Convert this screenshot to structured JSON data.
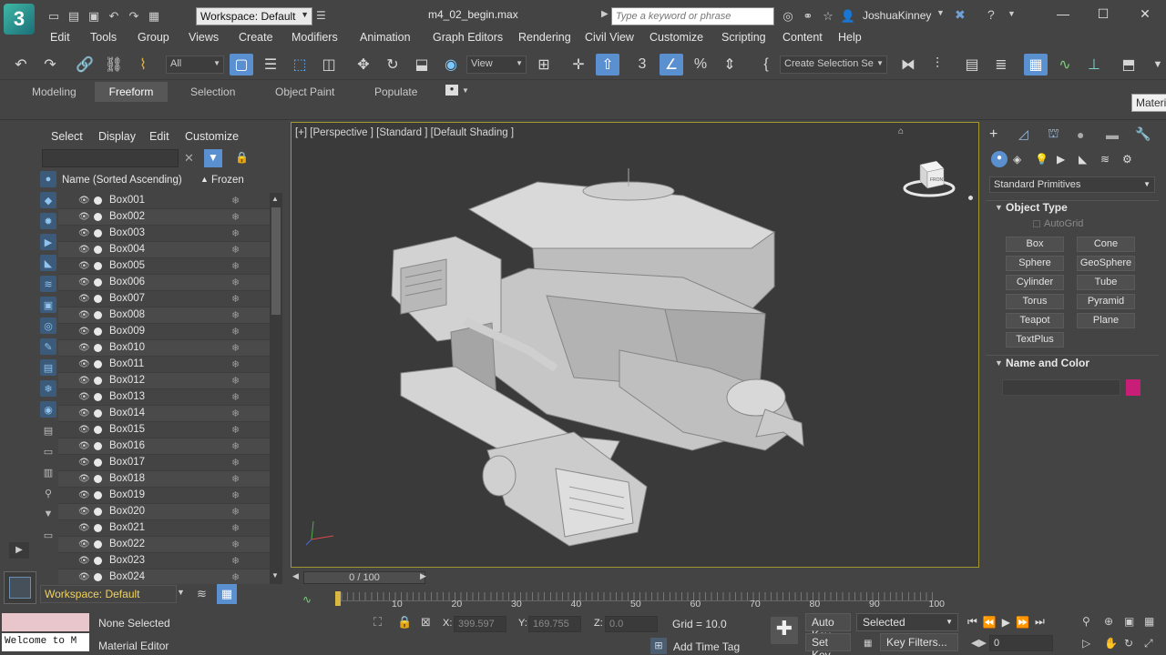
{
  "app": {
    "logo_text": "3",
    "workspace": "Workspace: Default",
    "file_name": "m4_02_begin.max",
    "search_placeholder": "Type a keyword or phrase",
    "user": "JoshuaKinney"
  },
  "menu": [
    "Edit",
    "Tools",
    "Group",
    "Views",
    "Create",
    "Modifiers",
    "Animation",
    "Graph Editors",
    "Rendering",
    "Civil View",
    "Customize",
    "Scripting",
    "Content",
    "Help"
  ],
  "toolbar": {
    "selection_filter": "All",
    "ref_coord": "View",
    "named_selection": "Create Selection Se"
  },
  "ribbon": {
    "tabs": [
      "Modeling",
      "Freeform",
      "Selection",
      "Object Paint",
      "Populate"
    ],
    "active": "Freeform"
  },
  "explorer": {
    "tabs": [
      "Select",
      "Display",
      "Edit",
      "Customize"
    ],
    "col_name": "Name (Sorted Ascending)",
    "col_frozen": "Frozen",
    "objects": [
      "Box001",
      "Box002",
      "Box003",
      "Box004",
      "Box005",
      "Box006",
      "Box007",
      "Box008",
      "Box009",
      "Box010",
      "Box011",
      "Box012",
      "Box013",
      "Box014",
      "Box015",
      "Box016",
      "Box017",
      "Box018",
      "Box019",
      "Box020",
      "Box021",
      "Box022",
      "Box023",
      "Box024"
    ],
    "workspace": "Workspace: Default"
  },
  "viewport": {
    "label": "[+] [Perspective ] [Standard ] [Default Shading ]",
    "viewcube_label": "FRONT"
  },
  "command_panel": {
    "category": "Standard Primitives",
    "object_type_title": "Object Type",
    "autogrid": "AutoGrid",
    "primitives": [
      "Box",
      "Cone",
      "Sphere",
      "GeoSphere",
      "Cylinder",
      "Tube",
      "Torus",
      "Pyramid",
      "Teapot",
      "Plane",
      "TextPlus"
    ],
    "name_color_title": "Name and Color",
    "swatch_color": "#c81e78"
  },
  "timeline": {
    "frame": "0 / 100",
    "ticks": [
      "10",
      "20",
      "30",
      "40",
      "50",
      "60",
      "70",
      "80",
      "90",
      "100"
    ]
  },
  "status": {
    "selection": "None Selected",
    "prompt": "Material Editor",
    "listener": "Welcome to M",
    "x_label": "X:",
    "x": "399.597",
    "y_label": "Y:",
    "y": "169.755",
    "z_label": "Z:",
    "z": "0.0",
    "grid": "Grid = 10.0",
    "add_time_tag": "Add Time Tag",
    "auto_key": "Auto Key",
    "set_key": "Set Key",
    "key_mode": "Selected",
    "key_filters": "Key Filters...",
    "current_frame": "0"
  },
  "tooltip": "Materi"
}
